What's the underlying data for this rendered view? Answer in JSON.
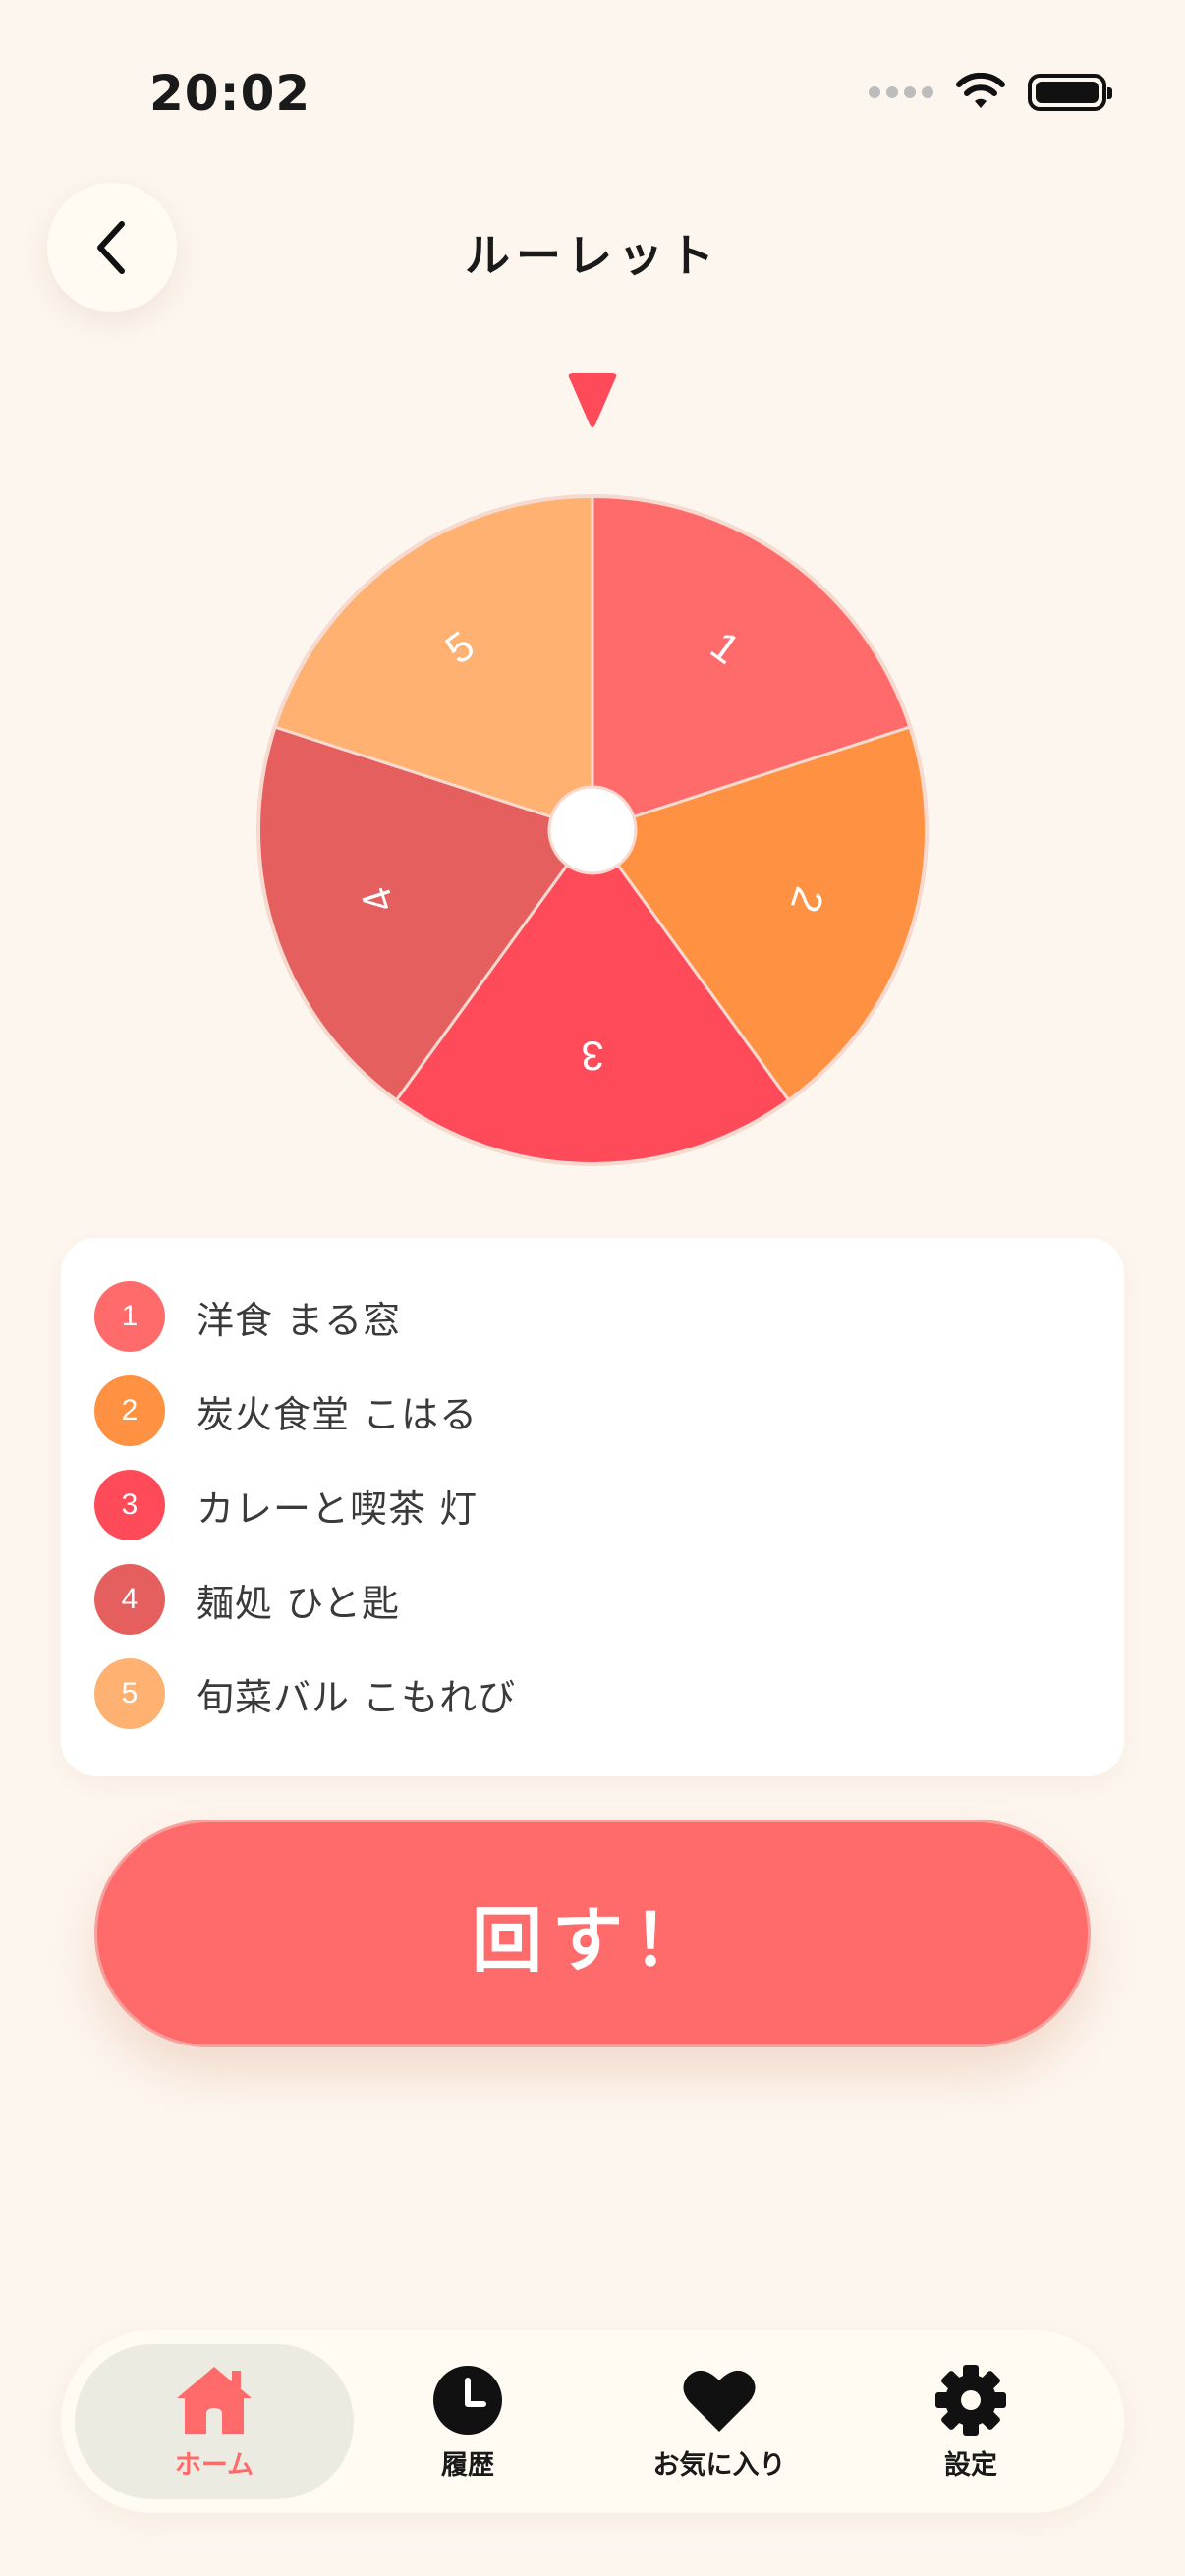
{
  "status_bar": {
    "time": "20:02"
  },
  "header": {
    "title": "ルーレット"
  },
  "wheel": {
    "segments": [
      {
        "number": "1",
        "color": "#ff6b6b"
      },
      {
        "number": "2",
        "color": "#ff9142"
      },
      {
        "number": "3",
        "color": "#ff4a5a"
      },
      {
        "number": "4",
        "color": "#e55f5f"
      },
      {
        "number": "5",
        "color": "#ffb171"
      }
    ]
  },
  "list": {
    "items": [
      {
        "number": "1",
        "label": "洋食 まる窓",
        "color": "#ff6b6b"
      },
      {
        "number": "2",
        "label": "炭火食堂 こはる",
        "color": "#ff9142"
      },
      {
        "number": "3",
        "label": "カレーと喫茶 灯",
        "color": "#ff4a5a"
      },
      {
        "number": "4",
        "label": "麺処 ひと匙",
        "color": "#e55f5f"
      },
      {
        "number": "5",
        "label": "旬菜バル こもれび",
        "color": "#ffb171"
      }
    ]
  },
  "spin_button": {
    "label": "回す！"
  },
  "tab_bar": {
    "tabs": [
      {
        "label": "ホーム",
        "icon": "home-icon",
        "active": true
      },
      {
        "label": "履歴",
        "icon": "clock-icon",
        "active": false
      },
      {
        "label": "お気に入り",
        "icon": "heart-icon",
        "active": false
      },
      {
        "label": "設定",
        "icon": "gear-icon",
        "active": false
      }
    ]
  },
  "colors": {
    "accent": "#ff6b6b",
    "background": "#fdf6ee",
    "pointer": "#ff4a5a"
  }
}
